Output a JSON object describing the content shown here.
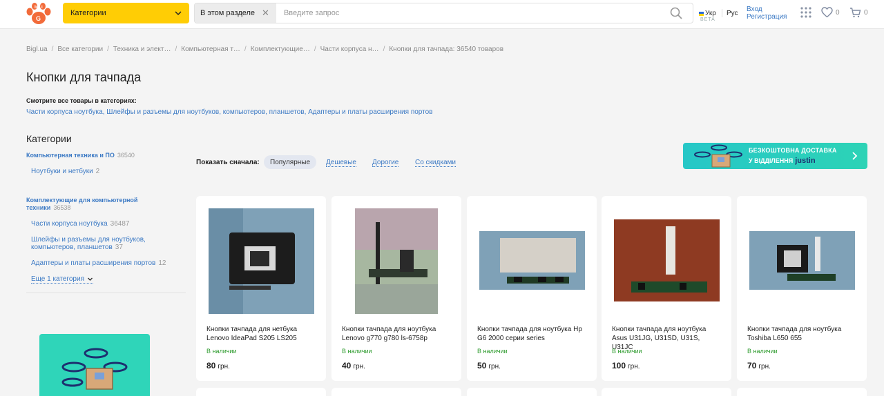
{
  "header": {
    "categories_label": "Категории",
    "search_scope": "В этом разделе",
    "search_placeholder": "Введите запрос",
    "lang_ukr": "Укр",
    "beta": "BETA",
    "lang_rus": "Рус",
    "login": "Вход",
    "register": "Регистрация",
    "favorites_count": "0",
    "cart_count": "0"
  },
  "breadcrumb": [
    "Bigl.ua",
    "Все категории",
    "Техника и элект…",
    "Компьютерная т…",
    "Комплектующие…",
    "Части корпуса н…",
    "Кнопки для тачпада: 36540 товаров"
  ],
  "page": {
    "title": "Кнопки для тачпада",
    "see_all": "Смотрите все товары в категориях:",
    "see_links": [
      "Части корпуса ноутбука",
      "Шлейфы и разъемы для ноутбуков, компьютеров, планшетов",
      "Адаптеры и платы расширения портов"
    ]
  },
  "sidebar": {
    "title": "Категории",
    "group1": {
      "label": "Компьютерная техника и ПО",
      "count": "36540"
    },
    "group1_items": [
      {
        "label": "Ноутбуки и нетбуки",
        "count": "2"
      }
    ],
    "group2": {
      "label_line1": "Комплектующие для компьютерной",
      "label_line2": "техники",
      "count": "36538"
    },
    "group2_items": [
      {
        "label": "Части корпуса ноутбука",
        "count": "36487"
      },
      {
        "label_line1": "Шлейфы и разъемы для ноутбуков,",
        "label_line2": "компьютеров, планшетов",
        "count": "37"
      },
      {
        "label": "Адаптеры и платы расширения портов",
        "count": "12"
      }
    ],
    "more": "Еще 1 категория"
  },
  "sort": {
    "label": "Показать сначала:",
    "options": [
      "Популярные",
      "Дешевые",
      "Дорогие",
      "Со скидками"
    ]
  },
  "promo": {
    "line1": "БЕЗКОШТОВНА ДОСТАВКА",
    "line2": "У ВІДДІЛЕННЯ",
    "brand": "justin"
  },
  "products": [
    {
      "name_line1": "Кнопки тачпада для нетбука",
      "name_line2": "Lenovo IdeaPad S205 LS205",
      "stock": "В наличии",
      "price": "80",
      "currency": "грн."
    },
    {
      "name_line1": "Кнопки тачпада для ноутбука",
      "name_line2": "Lenovo g770 g780 ls-6758p",
      "stock": "В наличии",
      "price": "40",
      "currency": "грн."
    },
    {
      "name_line1": "Кнопки тачпада для ноутбука Hp",
      "name_line2": "G6 2000 серии series",
      "stock": "В наличии",
      "price": "50",
      "currency": "грн."
    },
    {
      "name_line1": "Кнопки тачпада для ноутбука",
      "name_line2": "Asus U31JG, U31SD, U31S, U31JC",
      "stock": "В наличии",
      "price": "100",
      "currency": "грн."
    },
    {
      "name_line1": "Кнопки тачпада для ноутбука",
      "name_line2": "Toshiba L650 655",
      "stock": "В наличии",
      "price": "70",
      "currency": "грн."
    }
  ],
  "colors": {
    "accent_yellow": "#ffcd05",
    "link_blue": "#3b79c4",
    "in_stock_green": "#2e9b2e",
    "promo_teal": "#2dd3b6"
  },
  "icons": [
    "paw-logo-icon",
    "chevron-down-icon",
    "close-icon",
    "search-icon",
    "apps-grid-icon",
    "heart-icon",
    "cart-icon",
    "chevron-right-icon",
    "drone-icon"
  ]
}
